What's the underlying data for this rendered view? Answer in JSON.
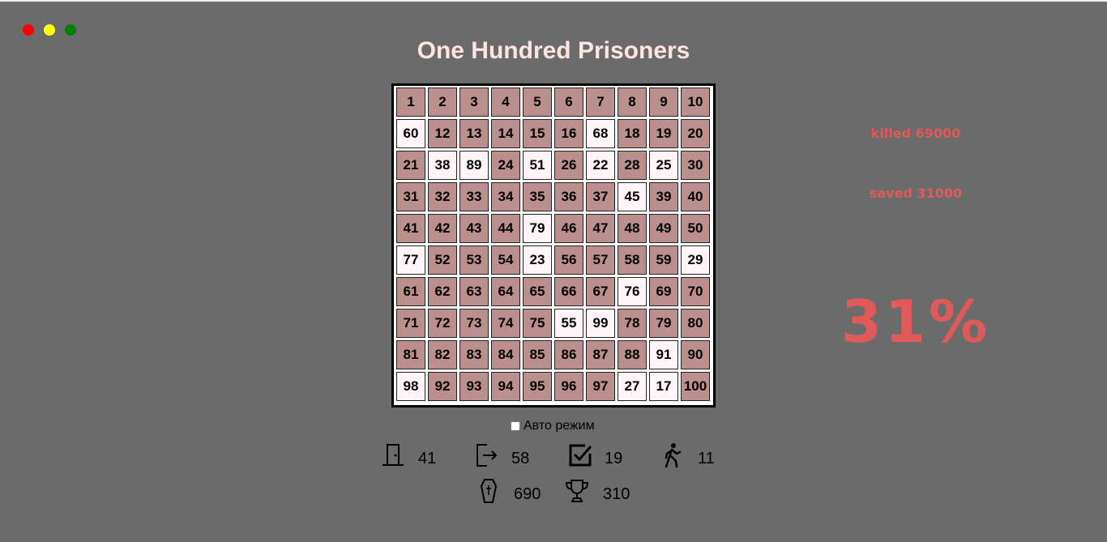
{
  "title": "One Hundred Prisoners",
  "window_dots": [
    {
      "color": "#ff0000"
    },
    {
      "color": "#ffff00"
    },
    {
      "color": "#008000"
    }
  ],
  "boxes": [
    {
      "n": "1",
      "open": false
    },
    {
      "n": "2",
      "open": false
    },
    {
      "n": "3",
      "open": false
    },
    {
      "n": "4",
      "open": false
    },
    {
      "n": "5",
      "open": false
    },
    {
      "n": "6",
      "open": false
    },
    {
      "n": "7",
      "open": false
    },
    {
      "n": "8",
      "open": false
    },
    {
      "n": "9",
      "open": false
    },
    {
      "n": "10",
      "open": false
    },
    {
      "n": "60",
      "open": true
    },
    {
      "n": "12",
      "open": false
    },
    {
      "n": "13",
      "open": false
    },
    {
      "n": "14",
      "open": false
    },
    {
      "n": "15",
      "open": false
    },
    {
      "n": "16",
      "open": false
    },
    {
      "n": "68",
      "open": true
    },
    {
      "n": "18",
      "open": false
    },
    {
      "n": "19",
      "open": false
    },
    {
      "n": "20",
      "open": false
    },
    {
      "n": "21",
      "open": false
    },
    {
      "n": "38",
      "open": true
    },
    {
      "n": "89",
      "open": true
    },
    {
      "n": "24",
      "open": false
    },
    {
      "n": "51",
      "open": true
    },
    {
      "n": "26",
      "open": false
    },
    {
      "n": "22",
      "open": true
    },
    {
      "n": "28",
      "open": false
    },
    {
      "n": "25",
      "open": true
    },
    {
      "n": "30",
      "open": false
    },
    {
      "n": "31",
      "open": false
    },
    {
      "n": "32",
      "open": false
    },
    {
      "n": "33",
      "open": false
    },
    {
      "n": "34",
      "open": false
    },
    {
      "n": "35",
      "open": false
    },
    {
      "n": "36",
      "open": false
    },
    {
      "n": "37",
      "open": false
    },
    {
      "n": "45",
      "open": true
    },
    {
      "n": "39",
      "open": false
    },
    {
      "n": "40",
      "open": false
    },
    {
      "n": "41",
      "open": false
    },
    {
      "n": "42",
      "open": false
    },
    {
      "n": "43",
      "open": false
    },
    {
      "n": "44",
      "open": false
    },
    {
      "n": "79",
      "open": true
    },
    {
      "n": "46",
      "open": false
    },
    {
      "n": "47",
      "open": false
    },
    {
      "n": "48",
      "open": false
    },
    {
      "n": "49",
      "open": false
    },
    {
      "n": "50",
      "open": false
    },
    {
      "n": "77",
      "open": true
    },
    {
      "n": "52",
      "open": false
    },
    {
      "n": "53",
      "open": false
    },
    {
      "n": "54",
      "open": false
    },
    {
      "n": "23",
      "open": true
    },
    {
      "n": "56",
      "open": false
    },
    {
      "n": "57",
      "open": false
    },
    {
      "n": "58",
      "open": false
    },
    {
      "n": "59",
      "open": false
    },
    {
      "n": "29",
      "open": true
    },
    {
      "n": "61",
      "open": false
    },
    {
      "n": "62",
      "open": false
    },
    {
      "n": "63",
      "open": false
    },
    {
      "n": "64",
      "open": false
    },
    {
      "n": "65",
      "open": false
    },
    {
      "n": "66",
      "open": false
    },
    {
      "n": "67",
      "open": false
    },
    {
      "n": "76",
      "open": true
    },
    {
      "n": "69",
      "open": false
    },
    {
      "n": "70",
      "open": false
    },
    {
      "n": "71",
      "open": false
    },
    {
      "n": "72",
      "open": false
    },
    {
      "n": "73",
      "open": false
    },
    {
      "n": "74",
      "open": false
    },
    {
      "n": "75",
      "open": false
    },
    {
      "n": "55",
      "open": true
    },
    {
      "n": "99",
      "open": true
    },
    {
      "n": "78",
      "open": false
    },
    {
      "n": "79",
      "open": false
    },
    {
      "n": "80",
      "open": false
    },
    {
      "n": "81",
      "open": false
    },
    {
      "n": "82",
      "open": false
    },
    {
      "n": "83",
      "open": false
    },
    {
      "n": "84",
      "open": false
    },
    {
      "n": "85",
      "open": false
    },
    {
      "n": "86",
      "open": false
    },
    {
      "n": "87",
      "open": false
    },
    {
      "n": "88",
      "open": false
    },
    {
      "n": "91",
      "open": true
    },
    {
      "n": "90",
      "open": false
    },
    {
      "n": "98",
      "open": true
    },
    {
      "n": "92",
      "open": false
    },
    {
      "n": "93",
      "open": false
    },
    {
      "n": "94",
      "open": false
    },
    {
      "n": "95",
      "open": false
    },
    {
      "n": "96",
      "open": false
    },
    {
      "n": "97",
      "open": false
    },
    {
      "n": "27",
      "open": true
    },
    {
      "n": "17",
      "open": true
    },
    {
      "n": "100",
      "open": false
    }
  ],
  "stats": {
    "killed": "killed 69000",
    "saved": "saved 31000",
    "percent": "31%"
  },
  "auto_mode": {
    "label": "Авто режим",
    "checked": false
  },
  "counters": {
    "door": "41",
    "exit": "58",
    "checked": "19",
    "walking": "11",
    "dead": "690",
    "trophy": "310"
  },
  "colors": {
    "background": "#6b6b6b",
    "closed_box": "#bc8f8f",
    "open_box": "#fff5f8",
    "stats_text": "#e05a5a",
    "title": "#ffe4e1"
  },
  "icons": [
    "door-icon",
    "exit-icon",
    "checkbox-icon",
    "walking-person-icon",
    "coffin-icon",
    "trophy-icon"
  ]
}
